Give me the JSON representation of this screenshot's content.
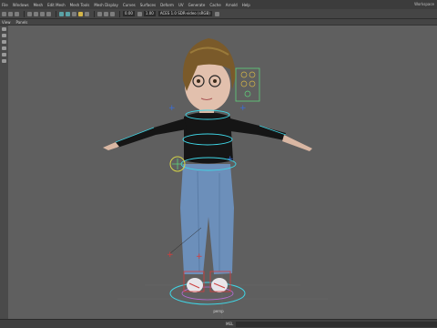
{
  "menubar": {
    "items": [
      "File",
      "Windows",
      "Mesh",
      "Edit Mesh",
      "Mesh Tools",
      "Mesh Display",
      "Curves",
      "Surfaces",
      "Deform",
      "UV",
      "Generate",
      "Cache",
      "Arnold",
      "Help"
    ],
    "right_text": "Workspace"
  },
  "toolbar": {
    "field1": "0.00",
    "field2": "1.00",
    "colorspace": "ACES 1.0 SDR-video (sRGB)"
  },
  "panel_menu": [
    "View",
    "Panels"
  ],
  "viewport": {
    "camera_label": "persp",
    "grid_color": "#5f5f5f",
    "rig_control_color": "#3fd6e6",
    "selected_control_color": "#5fd37a"
  },
  "statusbar": {
    "mel_label": "MEL"
  }
}
